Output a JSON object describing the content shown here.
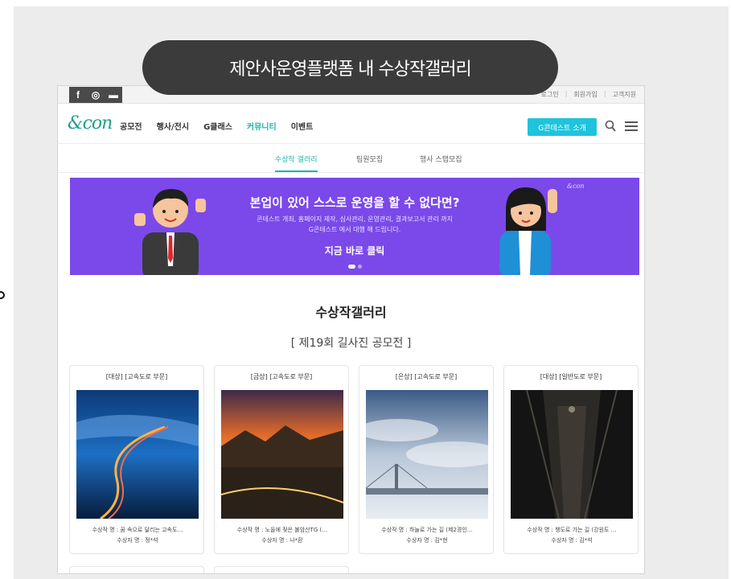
{
  "overlay_title": "제안사운영플랫폼 내 수상작갤러리",
  "topbar": {
    "social": [
      "f",
      "◎",
      "▬"
    ],
    "links": [
      "로그인",
      "회원가입",
      "고객지원"
    ]
  },
  "nav": {
    "logo": "&con",
    "menu": [
      "공모전",
      "행사/전시",
      "G클래스",
      "커뮤니티",
      "이벤트"
    ],
    "active_menu": "커뮤니티",
    "intro_button": "G콘테스트 소개"
  },
  "subnav": {
    "tabs": [
      "수상작 갤러리",
      "팀원모집",
      "행사 스탭모집"
    ],
    "active_tab": "수상작 갤러리"
  },
  "promo": {
    "headline": "본업이 있어 스스로 운영을 할 수 없다면?",
    "line1": "콘테스트 개최, 홈페이지 제작, 심사관리, 운영관리, 결과보고서 관리 까지",
    "line2": "G콘테스트 에서 대행 해 드립니다.",
    "cta": "지금 바로 클릭",
    "logo": "&con"
  },
  "gallery": {
    "title": "수상작갤러리",
    "subtitle": "[ 제19회 길사진 공모전 ]",
    "cards": [
      {
        "category": "[대상] [고속도로 부문]",
        "title": "수상작 명 : 꿈 속으로 달리는 고속도…",
        "author": "수상자 명 : 정*석"
      },
      {
        "category": "[금상] [고속도로 부문]",
        "title": "수상작 명 : 노을에 젖은 불암산TG (…",
        "author": "수상자 명 : 나*환"
      },
      {
        "category": "[은상] [고속도로 부문]",
        "title": "수상작 명 : 하늘로 가는 길 (제2경인…",
        "author": "수상자 명 : 김*현"
      },
      {
        "category": "[대상] [일반도로 부문]",
        "title": "수상작 명 : 챙도로 가는 길 (강원도 …",
        "author": "수상자 명 : 김*석"
      }
    ]
  }
}
